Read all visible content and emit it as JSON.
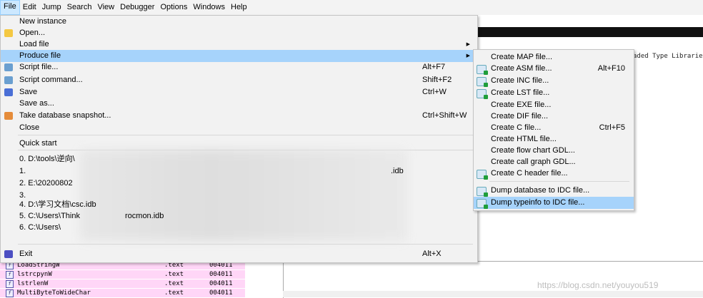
{
  "menubar": [
    "File",
    "Edit",
    "Jump",
    "Search",
    "View",
    "Debugger",
    "Options",
    "Windows",
    "Help"
  ],
  "background": {
    "tab_fragment": "aded Type Librarie",
    "functions": [
      {
        "name": "LoadStringW",
        "segment": ".text",
        "addr": "004011"
      },
      {
        "name": "lstrcpynW",
        "segment": ".text",
        "addr": "004011"
      },
      {
        "name": "lstrlenW",
        "segment": ".text",
        "addr": "004011"
      },
      {
        "name": "MultiByteToWideChar",
        "segment": ".text",
        "addr": "004011"
      }
    ],
    "watermark": "https://blog.csdn.net/youyou519"
  },
  "file_menu": {
    "new_instance": "New instance",
    "open": "Open...",
    "load_file": "Load file",
    "produce_file": "Produce file",
    "script_file": "Script file...",
    "script_file_sc": "Alt+F7",
    "script_command": "Script command...",
    "script_command_sc": "Shift+F2",
    "save": "Save",
    "save_sc": "Ctrl+W",
    "save_as": "Save as...",
    "snapshot": "Take database snapshot...",
    "snapshot_sc": "Ctrl+Shift+W",
    "close": "Close",
    "quick_start": "Quick start",
    "recent": [
      "0. D:\\tools\\逆向\\",
      "1. ",
      "2. E:\\20200802",
      "3. ",
      "4. D:\\学习文档\\csc.idb",
      "5. C:\\Users\\Think",
      "6. C:\\Users\\"
    ],
    "recent_tails": {
      "r1": ".idb",
      "r5": "rocmon.idb"
    },
    "exit": "Exit",
    "exit_sc": "Alt+X"
  },
  "produce_menu": {
    "items": [
      {
        "label": "Create MAP file...",
        "sc": ""
      },
      {
        "label": "Create ASM file...",
        "sc": "Alt+F10"
      },
      {
        "label": "Create INC file...",
        "sc": ""
      },
      {
        "label": "Create LST file...",
        "sc": ""
      },
      {
        "label": "Create EXE file...",
        "sc": ""
      },
      {
        "label": "Create DIF file...",
        "sc": ""
      },
      {
        "label": "Create C file...",
        "sc": "Ctrl+F5"
      },
      {
        "label": "Create HTML file...",
        "sc": ""
      },
      {
        "label": "Create flow chart GDL...",
        "sc": ""
      },
      {
        "label": "Create call graph GDL...",
        "sc": ""
      },
      {
        "label": "Create C header file...",
        "sc": ""
      },
      {
        "label": "Dump database to IDC file...",
        "sc": ""
      },
      {
        "label": "Dump typeinfo to IDC file...",
        "sc": ""
      }
    ]
  }
}
